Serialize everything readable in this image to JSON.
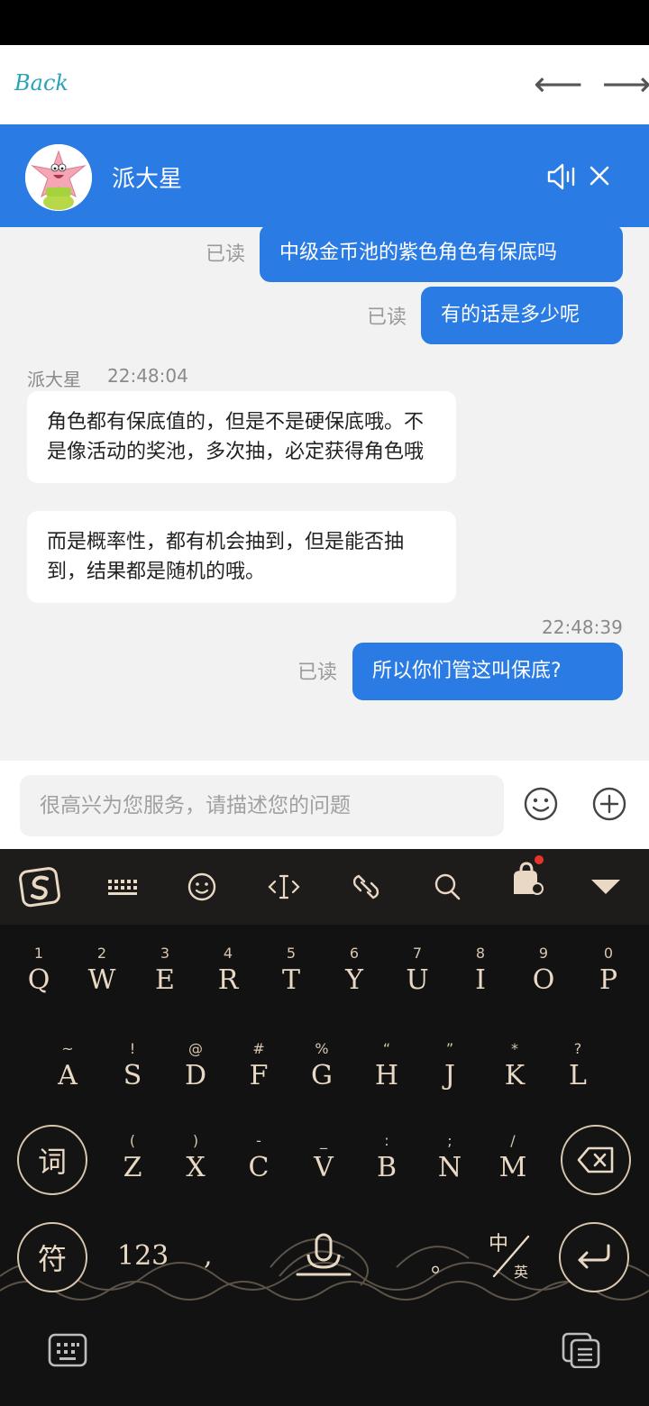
{
  "nav": {
    "back_label": "Back",
    "back_arrow": "⟵",
    "forward_arrow": "⟶"
  },
  "header": {
    "agent_name": "派大星"
  },
  "messages": {
    "out1": {
      "text": "中级金币池的紫色角色有保底吗",
      "status": "已读"
    },
    "out2": {
      "text": "有的话是多少呢",
      "status": "已读"
    },
    "agent_meta": {
      "sender": "派大星",
      "time": "22:48:04"
    },
    "in1": {
      "text": "角色都有保底值的，但是不是硬保底哦。不是像活动的奖池，多次抽，必定获得角色哦"
    },
    "in2": {
      "text": "而是概率性，都有机会抽到，但是能否抽到，结果都是随机的哦。"
    },
    "timestamp2": "22:48:39",
    "out3": {
      "text": "所以你们管这叫保底?",
      "status": "已读"
    }
  },
  "input": {
    "placeholder": "很高兴为您服务，请描述您的问题"
  },
  "keyboard": {
    "row1": [
      {
        "sup": "1",
        "key": "Q"
      },
      {
        "sup": "2",
        "key": "W"
      },
      {
        "sup": "3",
        "key": "E"
      },
      {
        "sup": "4",
        "key": "R"
      },
      {
        "sup": "5",
        "key": "T"
      },
      {
        "sup": "6",
        "key": "Y"
      },
      {
        "sup": "7",
        "key": "U"
      },
      {
        "sup": "8",
        "key": "I"
      },
      {
        "sup": "9",
        "key": "O"
      },
      {
        "sup": "0",
        "key": "P"
      }
    ],
    "row2": [
      {
        "sup": "~",
        "key": "A"
      },
      {
        "sup": "!",
        "key": "S"
      },
      {
        "sup": "@",
        "key": "D"
      },
      {
        "sup": "#",
        "key": "F"
      },
      {
        "sup": "%",
        "key": "G"
      },
      {
        "sup": "“",
        "key": "H"
      },
      {
        "sup": "”",
        "key": "J"
      },
      {
        "sup": "*",
        "key": "K"
      },
      {
        "sup": "?",
        "key": "L"
      }
    ],
    "row3": [
      {
        "sup": "(",
        "key": "Z"
      },
      {
        "sup": ")",
        "key": "X"
      },
      {
        "sup": "-",
        "key": "C"
      },
      {
        "sup": "_",
        "key": "V"
      },
      {
        "sup": ":",
        "key": "B"
      },
      {
        "sup": ";",
        "key": "N"
      },
      {
        "sup": "/",
        "key": "M"
      }
    ],
    "word_key": "词",
    "symbol_key": "符",
    "num_key": "123",
    "comma_key": ",",
    "period_key": "。",
    "lang_key_zh": "中",
    "lang_key_en": "英",
    "accent_color": "#e9d8c4",
    "notification_dot_color": "#e8322b"
  },
  "colors": {
    "header_blue": "#2b7be4",
    "chat_background": "#f2f2f2",
    "keyboard_background": "#121212"
  }
}
